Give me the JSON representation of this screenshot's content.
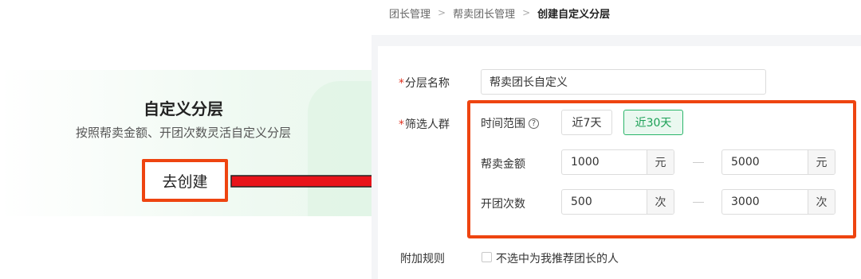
{
  "breadcrumb": {
    "items": [
      "团长管理",
      "帮卖团长管理",
      "创建自定义分层"
    ],
    "separator": ">"
  },
  "promo": {
    "title": "自定义分层",
    "subtitle": "按照帮卖金额、开团次数灵活自定义分层",
    "button_label": "去创建"
  },
  "form": {
    "layer_name": {
      "required_mark": "*",
      "label": "分层名称",
      "value": "帮卖团长自定义"
    },
    "filter_group": {
      "required_mark": "*",
      "label": "筛选人群",
      "time_range": {
        "label": "时间范围",
        "help_icon": "question-circle-icon",
        "help_glyph": "?",
        "options": [
          "近7天",
          "近30天"
        ],
        "selected": "近30天"
      },
      "sales_amount": {
        "label": "帮卖金额",
        "min": "1000",
        "max": "5000",
        "unit": "元"
      },
      "group_count": {
        "label": "开团次数",
        "min": "500",
        "max": "3000",
        "unit": "次"
      }
    },
    "extra_rule": {
      "label": "附加规则",
      "checkbox_label": "不选中为我推荐团长的人",
      "checked": false
    }
  },
  "colors": {
    "highlight": "#ee4410",
    "accent_green": "#2bb56a",
    "required": "#e0301e",
    "arrow_fill": "#e8141a"
  }
}
